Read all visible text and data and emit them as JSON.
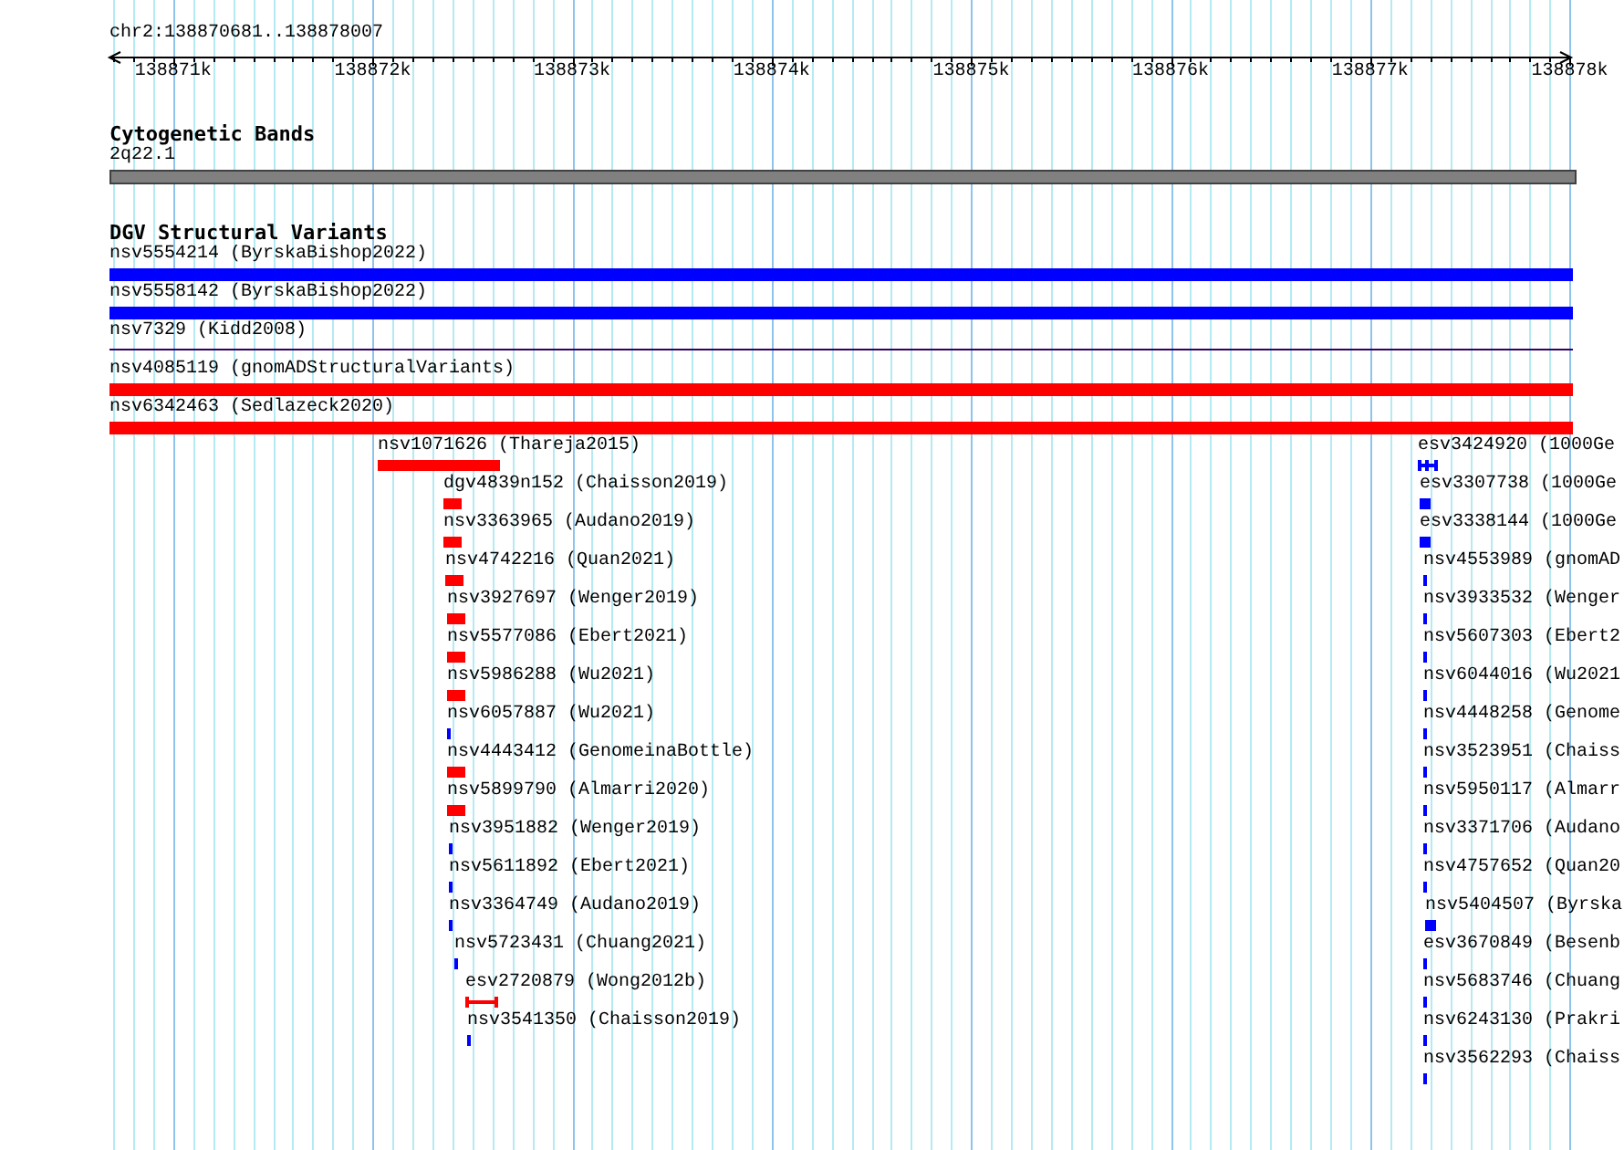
{
  "view": {
    "location": "chr2:138870681..138878007"
  },
  "ticks": [
    "138871k",
    "138872k",
    "138873k",
    "138874k",
    "138875k",
    "138876k",
    "138877k",
    "138878k"
  ],
  "cytoband_track": {
    "title": "Cytogenetic Bands",
    "band": "2q22.1"
  },
  "variant_track": {
    "title": "DGV Structural Variants",
    "features": [
      {
        "name": "nsv5554214 (ByrskaBishop2022)",
        "color": "#0000ff",
        "kind": "bar"
      },
      {
        "name": "nsv5558142 (ByrskaBishop2022)",
        "color": "#0000ff",
        "kind": "bar"
      },
      {
        "name": "nsv7329 (Kidd2008)",
        "color": "#330066",
        "kind": "line"
      },
      {
        "name": "nsv4085119 (gnomADStructuralVariants)",
        "color": "#ff0000",
        "kind": "bar"
      },
      {
        "name": "nsv6342463 (Sedlazeck2020)",
        "color": "#ff0000",
        "kind": "bar"
      },
      {
        "name": "nsv1071626 (Thareja2015)",
        "color": "#ff0000",
        "kind": "bar"
      },
      {
        "name": "dgv4839n152 (Chaisson2019)",
        "color": "#ff0000",
        "kind": "bar"
      },
      {
        "name": "nsv3363965 (Audano2019)",
        "color": "#ff0000",
        "kind": "bar"
      },
      {
        "name": "nsv4742216 (Quan2021)",
        "color": "#ff0000",
        "kind": "bar"
      },
      {
        "name": "nsv3927697 (Wenger2019)",
        "color": "#ff0000",
        "kind": "bar"
      },
      {
        "name": "nsv5577086 (Ebert2021)",
        "color": "#ff0000",
        "kind": "bar"
      },
      {
        "name": "nsv5986288 (Wu2021)",
        "color": "#ff0000",
        "kind": "bar"
      },
      {
        "name": "nsv6057887 (Wu2021)",
        "color": "#0000ff",
        "kind": "bar"
      },
      {
        "name": "nsv4443412 (GenomeinaBottle)",
        "color": "#ff0000",
        "kind": "bar"
      },
      {
        "name": "nsv5899790 (Almarri2020)",
        "color": "#ff0000",
        "kind": "bar"
      },
      {
        "name": "nsv3951882 (Wenger2019)",
        "color": "#0000ff",
        "kind": "bar"
      },
      {
        "name": "nsv5611892 (Ebert2021)",
        "color": "#0000ff",
        "kind": "bar"
      },
      {
        "name": "nsv3364749 (Audano2019)",
        "color": "#0000ff",
        "kind": "bar"
      },
      {
        "name": "nsv5723431 (Chuang2021)",
        "color": "#0000ff",
        "kind": "bar"
      },
      {
        "name": "esv2720879 (Wong2012b)",
        "color": "#ff0000",
        "kind": "bracket"
      },
      {
        "name": "nsv3541350 (Chaisson2019)",
        "color": "#0000ff",
        "kind": "bar"
      },
      {
        "name": "esv3424920 (1000Ge",
        "color": "#0000ff",
        "kind": "split"
      },
      {
        "name": "esv3307738 (1000Ge",
        "color": "#0000ff",
        "kind": "bar"
      },
      {
        "name": "esv3338144 (1000Ge",
        "color": "#0000ff",
        "kind": "bar"
      },
      {
        "name": "nsv4553989 (gnomAD",
        "color": "#0000ff",
        "kind": "bar"
      },
      {
        "name": "nsv3933532 (Wenger",
        "color": "#0000ff",
        "kind": "bar"
      },
      {
        "name": "nsv5607303 (Ebert2",
        "color": "#0000ff",
        "kind": "bar"
      },
      {
        "name": "nsv6044016 (Wu2021",
        "color": "#0000ff",
        "kind": "bar"
      },
      {
        "name": "nsv4448258 (Genome",
        "color": "#0000ff",
        "kind": "bar"
      },
      {
        "name": "nsv3523951 (Chaiss",
        "color": "#0000ff",
        "kind": "bar"
      },
      {
        "name": "nsv5950117 (Almarr",
        "color": "#0000ff",
        "kind": "bar"
      },
      {
        "name": "nsv3371706 (Audano",
        "color": "#0000ff",
        "kind": "bar"
      },
      {
        "name": "nsv4757652 (Quan20",
        "color": "#0000ff",
        "kind": "bar"
      },
      {
        "name": "nsv5404507 (Byrska",
        "color": "#0000ff",
        "kind": "bar"
      },
      {
        "name": "esv3670849 (Besenb",
        "color": "#0000ff",
        "kind": "bar"
      },
      {
        "name": "nsv5683746 (Chuang",
        "color": "#0000ff",
        "kind": "bar"
      },
      {
        "name": "nsv6243130 (Prakri",
        "color": "#0000ff",
        "kind": "bar"
      },
      {
        "name": "nsv3562293 (Chaiss",
        "color": "#0000ff",
        "kind": "bar"
      }
    ]
  }
}
